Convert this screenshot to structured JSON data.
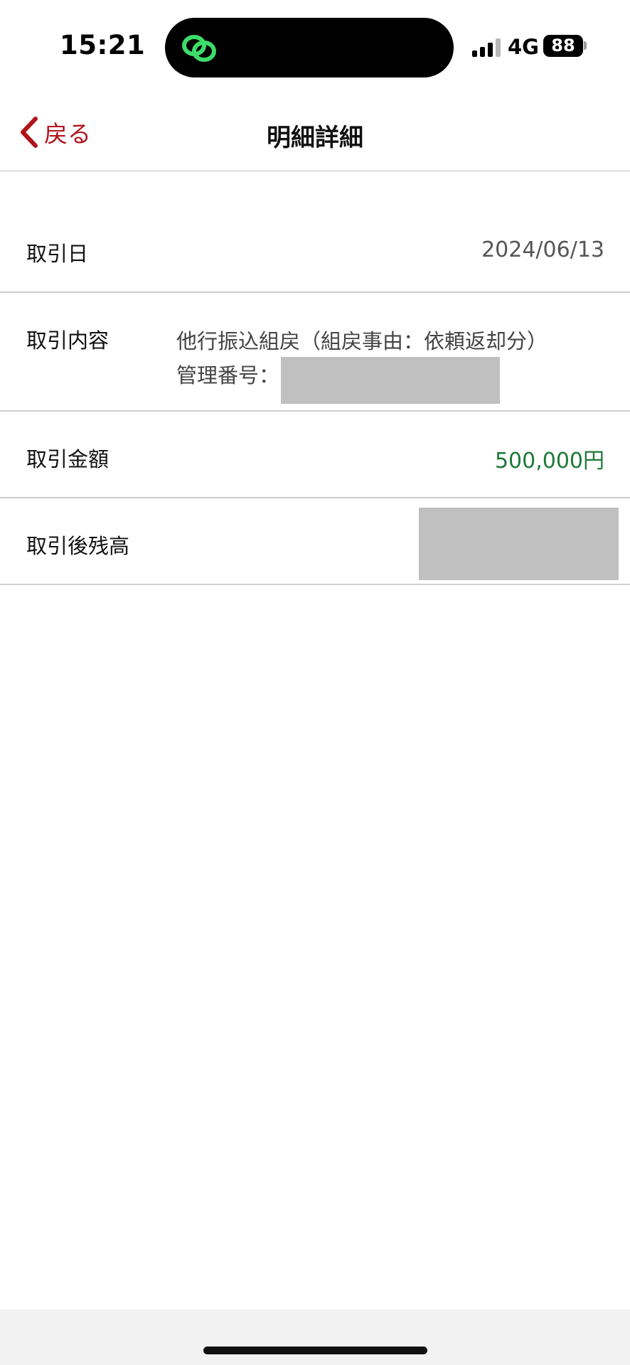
{
  "status_bar": {
    "time": "15:21",
    "network": "4G",
    "battery": "88",
    "island_icon": "green-link-icon",
    "island_icon_color": "#3ddc6a"
  },
  "nav": {
    "back_label": "戻る",
    "title": "明細詳細",
    "accent_color": "#b0141b"
  },
  "details": {
    "date_label": "取引日",
    "date_value": "2024/06/13",
    "description_label": "取引内容",
    "description_line1": "他行振込組戻（組戻事由：依頼返却分）",
    "description_line2_prefix": "管理番号：",
    "amount_label": "取引金額",
    "amount_value": "500,000円",
    "amount_color": "#1d7a3a",
    "balance_label": "取引後残高"
  }
}
